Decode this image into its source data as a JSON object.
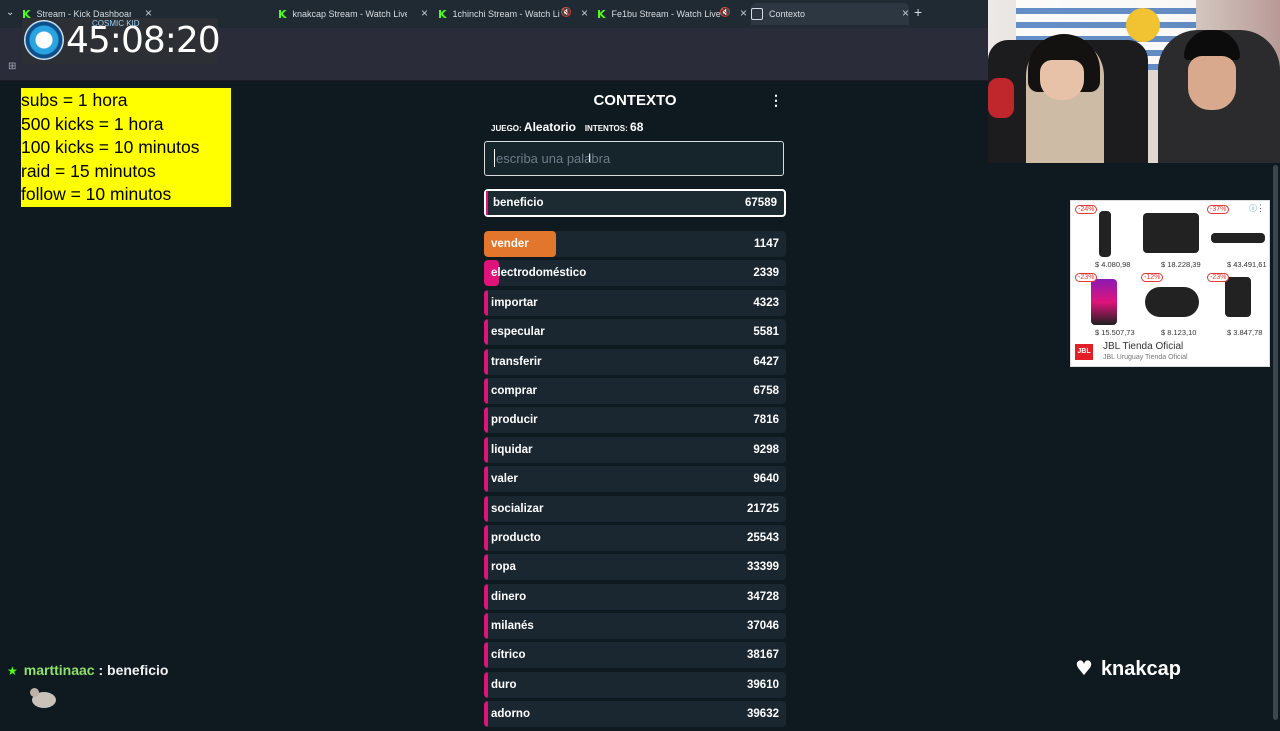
{
  "browser": {
    "tabs": [
      {
        "label": "Stream - Kick Dashboard",
        "type": "kick"
      },
      {
        "label": "knakcap Stream - Watch Live o",
        "type": "kick"
      },
      {
        "label": "1chinchi Stream - Watch Li",
        "type": "kick",
        "muted": true
      },
      {
        "label": "Fe1bu Stream - Watch Live",
        "type": "kick",
        "muted": true
      },
      {
        "label": "Contexto",
        "type": "active"
      }
    ],
    "new_tab": "+",
    "close": "×"
  },
  "timer": {
    "brand": "COSMIC KID",
    "time": "45:08:20"
  },
  "rules": [
    "subs = 1 hora",
    "500 kicks = 1 hora",
    "100 kicks = 10 minutos",
    "raid = 15 minutos",
    "follow = 10 minutos"
  ],
  "game": {
    "title": "CONTEXTO",
    "menu": "⋮",
    "juego_label": "JUEGO:",
    "juego_value": "Aleatorio",
    "intentos_label": "INTENTOS:",
    "intentos_value": "68",
    "search_placeholder": "escriba una palabra",
    "current_guess": {
      "word": "beneficio",
      "score": "67589"
    },
    "guesses": [
      {
        "word": "vender",
        "score": "1147",
        "color": "#e2762d",
        "fill": 0.24
      },
      {
        "word": "electrodoméstico",
        "score": "2339",
        "color": "#e0137b",
        "fill": 0.05
      },
      {
        "word": "importar",
        "score": "4323",
        "color": "#e0137b",
        "fill": 0.01
      },
      {
        "word": "especular",
        "score": "5581",
        "color": "#e0137b",
        "fill": 0.01
      },
      {
        "word": "transferir",
        "score": "6427",
        "color": "#e0137b",
        "fill": 0.01
      },
      {
        "word": "comprar",
        "score": "6758",
        "color": "#e0137b",
        "fill": 0.01
      },
      {
        "word": "producir",
        "score": "7816",
        "color": "#e0137b",
        "fill": 0.01
      },
      {
        "word": "liquidar",
        "score": "9298",
        "color": "#e0137b",
        "fill": 0.01
      },
      {
        "word": "valer",
        "score": "9640",
        "color": "#e0137b",
        "fill": 0.01
      },
      {
        "word": "socializar",
        "score": "21725",
        "color": "#e0137b",
        "fill": 0.01
      },
      {
        "word": "producto",
        "score": "25543",
        "color": "#e0137b",
        "fill": 0.01
      },
      {
        "word": "ropa",
        "score": "33399",
        "color": "#e0137b",
        "fill": 0.01
      },
      {
        "word": "dinero",
        "score": "34728",
        "color": "#e0137b",
        "fill": 0.01
      },
      {
        "word": "milanés",
        "score": "37046",
        "color": "#e0137b",
        "fill": 0.01
      },
      {
        "word": "cítrico",
        "score": "38167",
        "color": "#e0137b",
        "fill": 0.01
      },
      {
        "word": "duro",
        "score": "39610",
        "color": "#e0137b",
        "fill": 0.01
      },
      {
        "word": "adorno",
        "score": "39632",
        "color": "#e0137b",
        "fill": 0.01
      }
    ]
  },
  "ad": {
    "items": [
      {
        "badge": "-24%",
        "price": "$ 4.080,98"
      },
      {
        "badge": "",
        "price": "$ 18.228,39"
      },
      {
        "badge": "-37%",
        "price": "$ 43.491,61"
      },
      {
        "badge": "-23%",
        "price": "$ 15.507,73"
      },
      {
        "badge": "-12%",
        "price": "$ 8.123,10"
      },
      {
        "badge": "-23%",
        "price": "$ 3.847,78"
      }
    ],
    "logo": "JBL",
    "title": "JBL Tienda Oficial",
    "subtitle": "JBL Uruguay Tienda Oficial"
  },
  "chat": {
    "user": "marttinaac",
    "separator": " : ",
    "message": "beneficio"
  },
  "follow": {
    "name": "knakcap"
  }
}
